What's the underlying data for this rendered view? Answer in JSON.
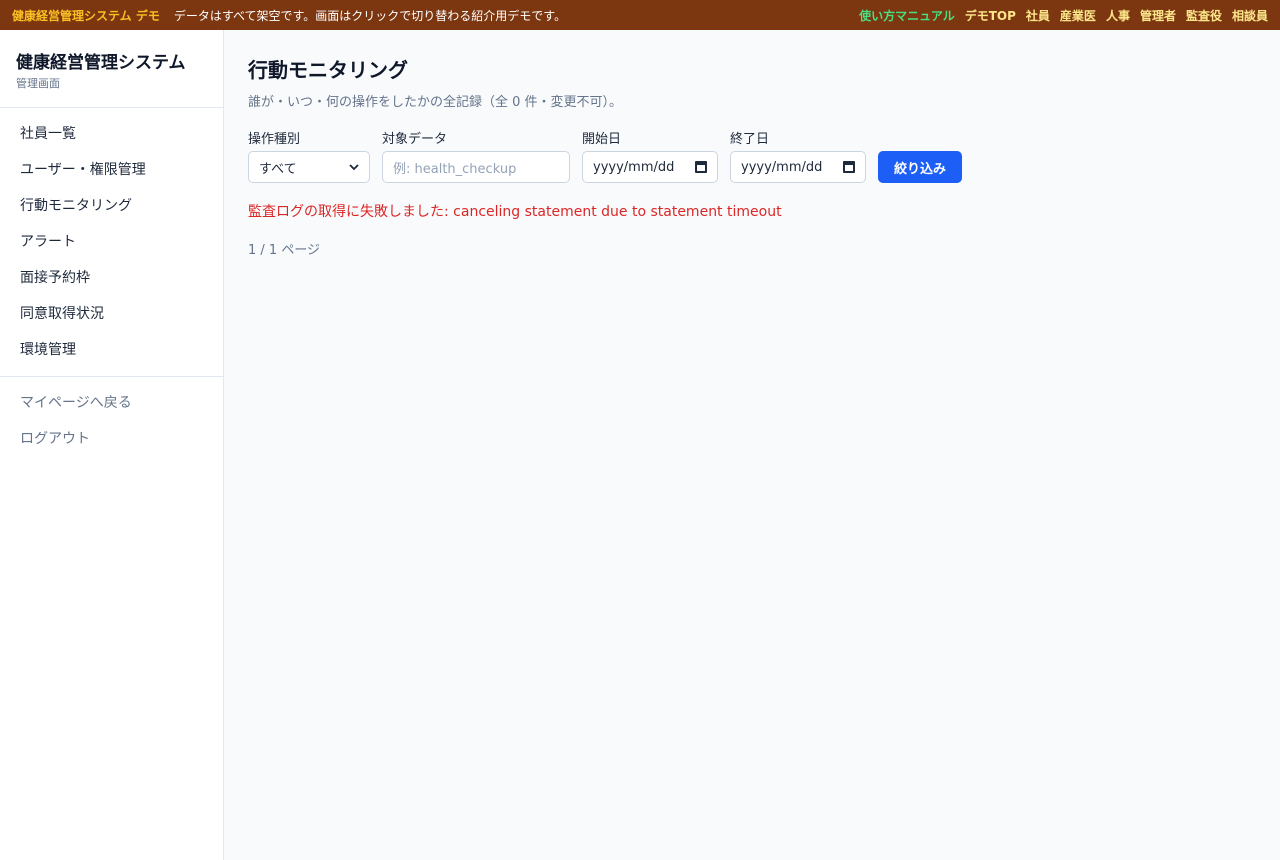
{
  "topbar": {
    "brand": "健康経営管理システム デモ",
    "notice": "データはすべて架空です。画面はクリックで切り替わる紹介用デモです。",
    "links": [
      "使い方マニュアル",
      "デモTOP",
      "社員",
      "産業医",
      "人事",
      "管理者",
      "監査役",
      "相談員"
    ]
  },
  "sidebar": {
    "title": "健康経営管理システム",
    "subtitle": "管理画面",
    "items": [
      {
        "label": "社員一覧"
      },
      {
        "label": "ユーザー・権限管理"
      },
      {
        "label": "行動モニタリング"
      },
      {
        "label": "アラート"
      },
      {
        "label": "面接予約枠"
      },
      {
        "label": "同意取得状況"
      },
      {
        "label": "環境管理"
      }
    ],
    "secondary": [
      {
        "label": "マイページへ戻る"
      },
      {
        "label": "ログアウト"
      }
    ]
  },
  "main": {
    "title": "行動モニタリング",
    "description": "誰が・いつ・何の操作をしたかの全記録（全 0 件・変更不可）。",
    "filters": {
      "operation_label": "操作種別",
      "operation_value": "すべて",
      "target_label": "対象データ",
      "target_placeholder": "例: health_checkup",
      "start_label": "開始日",
      "start_placeholder": "yyyy/mm/dd",
      "end_label": "終了日",
      "end_placeholder": "yyyy/mm/dd",
      "submit_label": "絞り込み"
    },
    "error": "監査ログの取得に失敗しました: canceling statement due to statement timeout",
    "pager": "1 / 1 ページ"
  }
}
